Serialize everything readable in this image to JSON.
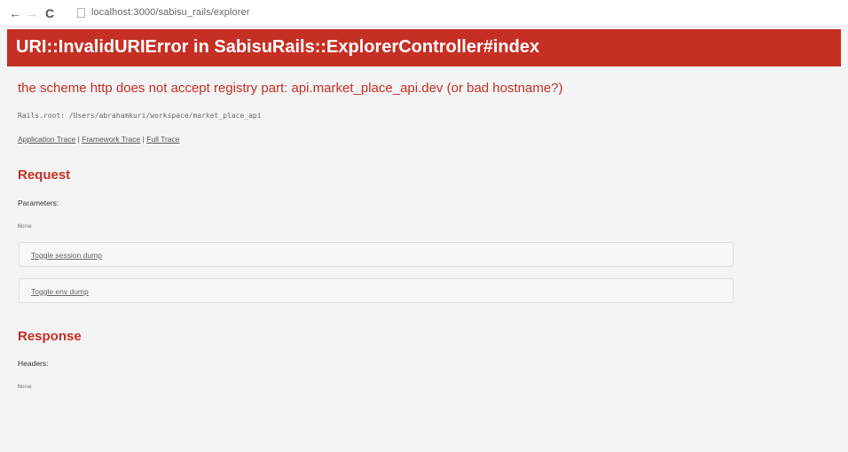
{
  "browser": {
    "back_glyph": "←",
    "forward_glyph": "→",
    "reload_glyph": "C",
    "url": "localhost:3000/sabisu_rails/explorer"
  },
  "error": {
    "title": "URI::InvalidURIError in SabisuRails::ExplorerController#index",
    "message": "the scheme http does not accept registry part: api.market_place_api.dev (or bad hostname?)",
    "rails_root": "Rails.root: /Users/abrahamkuri/workspace/market_place_api"
  },
  "trace_links": {
    "application": "Application Trace",
    "sep1": " | ",
    "framework": "Framework Trace",
    "sep2": " | ",
    "full": "Full Trace"
  },
  "request": {
    "title": "Request",
    "parameters_label": "Parameters:",
    "parameters_value": "None",
    "toggle_session": "Toggle session dump",
    "toggle_env": "Toggle env dump"
  },
  "response": {
    "title": "Response",
    "headers_label": "Headers:",
    "headers_value": "None"
  },
  "colors": {
    "banner": "#c52f24",
    "heading": "#c52f24",
    "background": "#f4f4f4"
  }
}
